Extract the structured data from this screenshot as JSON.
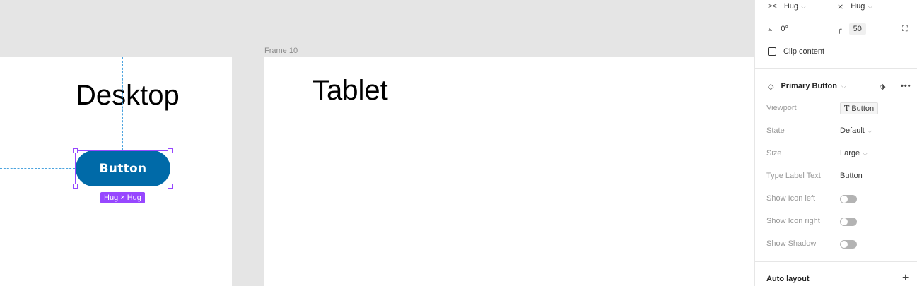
{
  "canvas": {
    "frame_label": "Frame 10",
    "desktop_heading": "Desktop",
    "tablet_heading": "Tablet",
    "button_label": "Button",
    "size_badge": "Hug × Hug"
  },
  "panel": {
    "width_mode": "Hug",
    "height_mode": "Hug",
    "rotation": "0°",
    "corner_radius": "50",
    "clip_content_label": "Clip content",
    "component_name": "Primary Button",
    "properties": [
      {
        "label": "Viewport",
        "value": "Button"
      },
      {
        "label": "State",
        "value": "Default"
      },
      {
        "label": "Size",
        "value": "Large"
      },
      {
        "label": "Type Label Text",
        "value": "Button"
      },
      {
        "label": "Show Icon left",
        "value": "off"
      },
      {
        "label": "Show Icon right",
        "value": "off"
      },
      {
        "label": "Show Shadow",
        "value": "off"
      }
    ],
    "auto_layout_title": "Auto layout"
  },
  "colors": {
    "canvas_bg": "#e5e5e5",
    "button_bg": "#006aa8",
    "selection": "#9747ff",
    "guide": "#4aa3df"
  }
}
